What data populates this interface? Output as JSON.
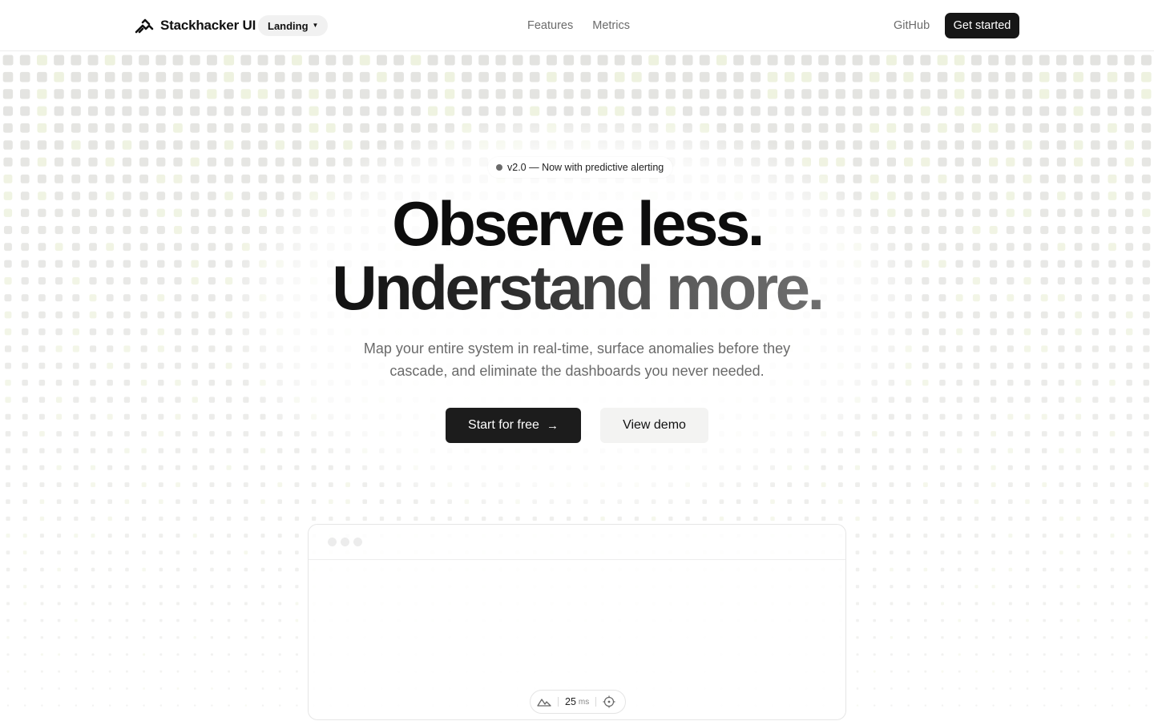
{
  "header": {
    "brand_name": "Stackhacker UI",
    "variant": "Landing",
    "nav": [
      "Features",
      "Metrics"
    ],
    "github_label": "GitHub",
    "cta_label": "Get started"
  },
  "hero": {
    "badge_text": "v2.0 — Now with predictive alerting",
    "headline_line1": "Observe less.",
    "headline_line2": "Understand more.",
    "subtext": "Map your entire system in real-time, surface anomalies before they cascade, and eliminate the dashboards you never needed.",
    "primary_cta": "Start for free",
    "secondary_cta": "View demo"
  },
  "preview": {
    "latency_value": "25",
    "latency_unit": "ms"
  },
  "colors": {
    "accent_dark": "#161616",
    "grid_square": "#e3e3e0",
    "grid_square_highlight": "#eef2df"
  },
  "icons": [
    "stackhacker-logo-icon",
    "caret-down-icon",
    "arrow-right-icon",
    "mountain-icon",
    "crosshair-icon"
  ]
}
